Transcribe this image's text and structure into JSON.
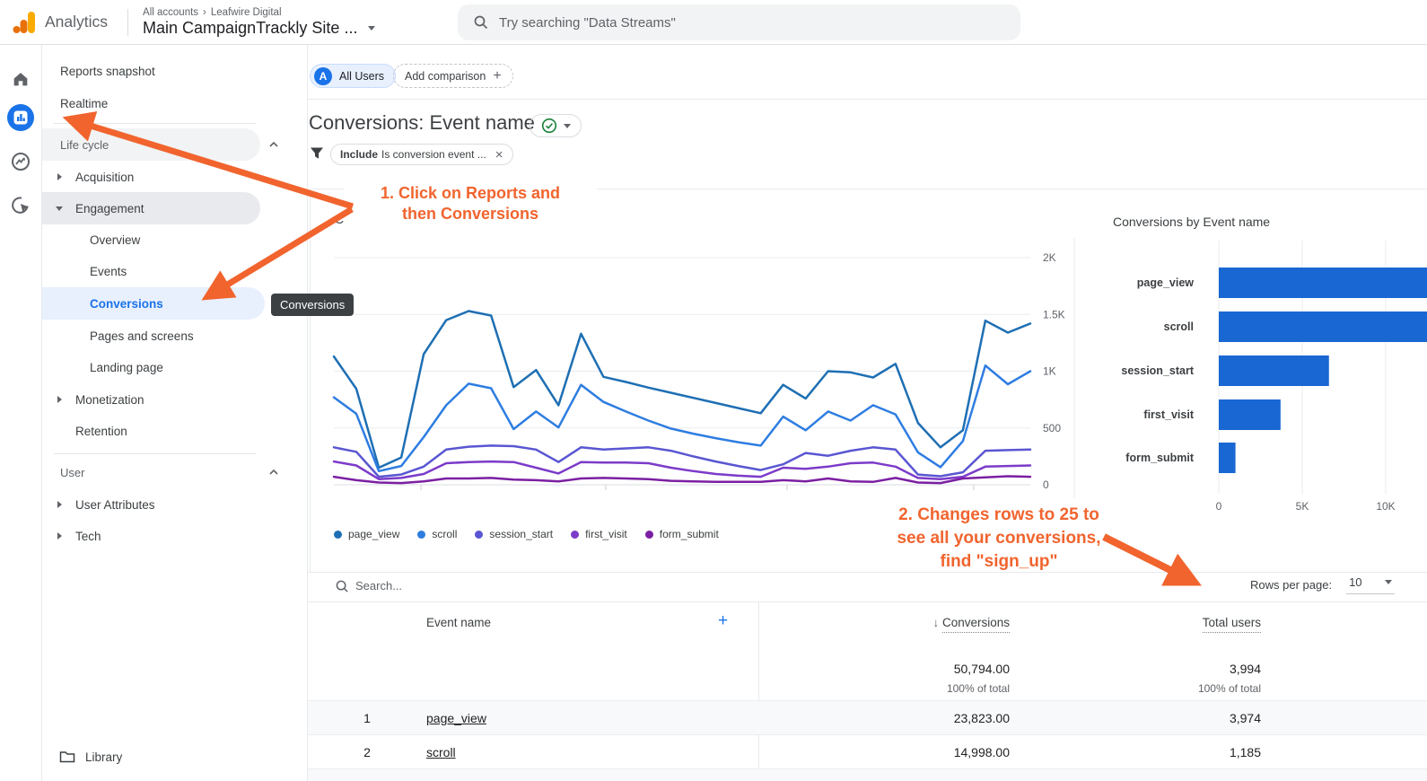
{
  "topbar": {
    "product": "Analytics",
    "breadcrumb_root": "All accounts",
    "breadcrumb_sep": "›",
    "breadcrumb_org": "Leafwire Digital",
    "property_name": "Main CampaignTrackly Site ...",
    "search_placeholder": "Try searching \"Data Streams\""
  },
  "sidebar": {
    "reports_snapshot": "Reports snapshot",
    "realtime": "Realtime",
    "lifecycle_header": "Life cycle",
    "acquisition": "Acquisition",
    "engagement": "Engagement",
    "overview": "Overview",
    "events": "Events",
    "conversions": "Conversions",
    "pages_and_screens": "Pages and screens",
    "landing_page": "Landing page",
    "monetization": "Monetization",
    "retention": "Retention",
    "user_header": "User",
    "user_attributes": "User Attributes",
    "tech": "Tech",
    "library": "Library"
  },
  "tooltip": {
    "text": "Conversions"
  },
  "report_header": {
    "avatar_letter": "A",
    "all_users": "All Users",
    "add_comparison": "Add comparison",
    "add_plus": "+",
    "title": "Conversions: Event name",
    "filter_include": "Include",
    "filter_text": "Is conversion event ...",
    "filter_close": "×"
  },
  "annotations": {
    "accent_color": "#f1642e",
    "step1_line1": "1. Click on Reports and",
    "step1_line2": "then Conversions",
    "step2_line1": "2. Changes rows to 25 to",
    "step2_line2": "see all your conversions,",
    "step2_line3": "find \"sign_up\""
  },
  "charts": {
    "line_title_fragment": "Co",
    "bar_title": "Conversions by Event name"
  },
  "chart_data": [
    {
      "type": "line",
      "title_visible_fragment": "Co",
      "ylim": [
        0,
        2000
      ],
      "y_ticks": [
        {
          "label": "0",
          "value": 0
        },
        {
          "label": "500",
          "value": 500
        },
        {
          "label": "1K",
          "value": 1000
        },
        {
          "label": "1.5K",
          "value": 1500
        },
        {
          "label": "2K",
          "value": 2000
        }
      ],
      "x_labels_visible": false,
      "x_points": 32,
      "values_estimated": true,
      "series": [
        {
          "name": "page_view",
          "color": "#1e6fb3",
          "values": [
            1130,
            845,
            150,
            240,
            1150,
            1450,
            1530,
            1490,
            860,
            1010,
            700,
            1330,
            950,
            905,
            855,
            810,
            765,
            720,
            675,
            630,
            880,
            760,
            1000,
            990,
            945,
            1065,
            545,
            330,
            480,
            1445,
            1340,
            1420
          ]
        },
        {
          "name": "scroll",
          "color": "#2e7de1",
          "values": [
            770,
            625,
            120,
            165,
            420,
            700,
            890,
            850,
            490,
            645,
            505,
            880,
            730,
            645,
            565,
            495,
            450,
            410,
            375,
            345,
            600,
            480,
            645,
            565,
            700,
            620,
            285,
            155,
            385,
            1050,
            885,
            1000
          ]
        },
        {
          "name": "session_start",
          "color": "#5956d2",
          "values": [
            330,
            290,
            70,
            90,
            160,
            310,
            335,
            345,
            340,
            310,
            200,
            330,
            310,
            320,
            330,
            300,
            250,
            205,
            165,
            130,
            180,
            280,
            255,
            300,
            330,
            310,
            90,
            75,
            110,
            300,
            305,
            310
          ]
        },
        {
          "name": "first_visit",
          "color": "#7c3bc9",
          "values": [
            205,
            170,
            50,
            60,
            95,
            190,
            200,
            205,
            200,
            150,
            100,
            200,
            195,
            195,
            190,
            150,
            120,
            95,
            80,
            70,
            150,
            140,
            160,
            190,
            195,
            160,
            60,
            50,
            70,
            160,
            165,
            170
          ]
        },
        {
          "name": "form_submit",
          "color": "#7b1fa2",
          "values": [
            70,
            40,
            20,
            15,
            30,
            55,
            55,
            60,
            45,
            40,
            30,
            55,
            60,
            55,
            50,
            35,
            30,
            25,
            25,
            25,
            40,
            30,
            55,
            30,
            25,
            60,
            20,
            15,
            55,
            65,
            75,
            70
          ]
        }
      ]
    },
    {
      "type": "bar",
      "orientation": "horizontal",
      "title": "Conversions by Event name",
      "categories": [
        "page_view",
        "scroll",
        "session_start",
        "first_visit",
        "form_submit"
      ],
      "values": [
        23823,
        14998,
        6600,
        3700,
        1000
      ],
      "bar_color": "#1967d2",
      "x_ticks": [
        {
          "label": "0",
          "value": 0
        },
        {
          "label": "5K",
          "value": 5000
        },
        {
          "label": "10K",
          "value": 10000
        }
      ],
      "x_visible_max": 12400,
      "clipped_bars": [
        "page_view",
        "scroll"
      ],
      "values_estimated_for": [
        "session_start",
        "first_visit",
        "form_submit"
      ]
    }
  ],
  "table": {
    "search_placeholder": "Search...",
    "rows_per_page_label": "Rows per page:",
    "rows_per_page_value": "10",
    "col_event_name": "Event name",
    "add_column": "+",
    "sort_arrow": "↓",
    "col_conversions": "Conversions",
    "col_total_users": "Total users",
    "totals": {
      "conversions": "50,794.00",
      "conversions_pct": "100% of total",
      "total_users": "3,994",
      "total_users_pct": "100% of total"
    },
    "rows": [
      {
        "rank": "1",
        "event": "page_view",
        "conversions": "23,823.00",
        "total_users": "3,974"
      },
      {
        "rank": "2",
        "event": "scroll",
        "conversions": "14,998.00",
        "total_users": "1,185"
      }
    ]
  }
}
